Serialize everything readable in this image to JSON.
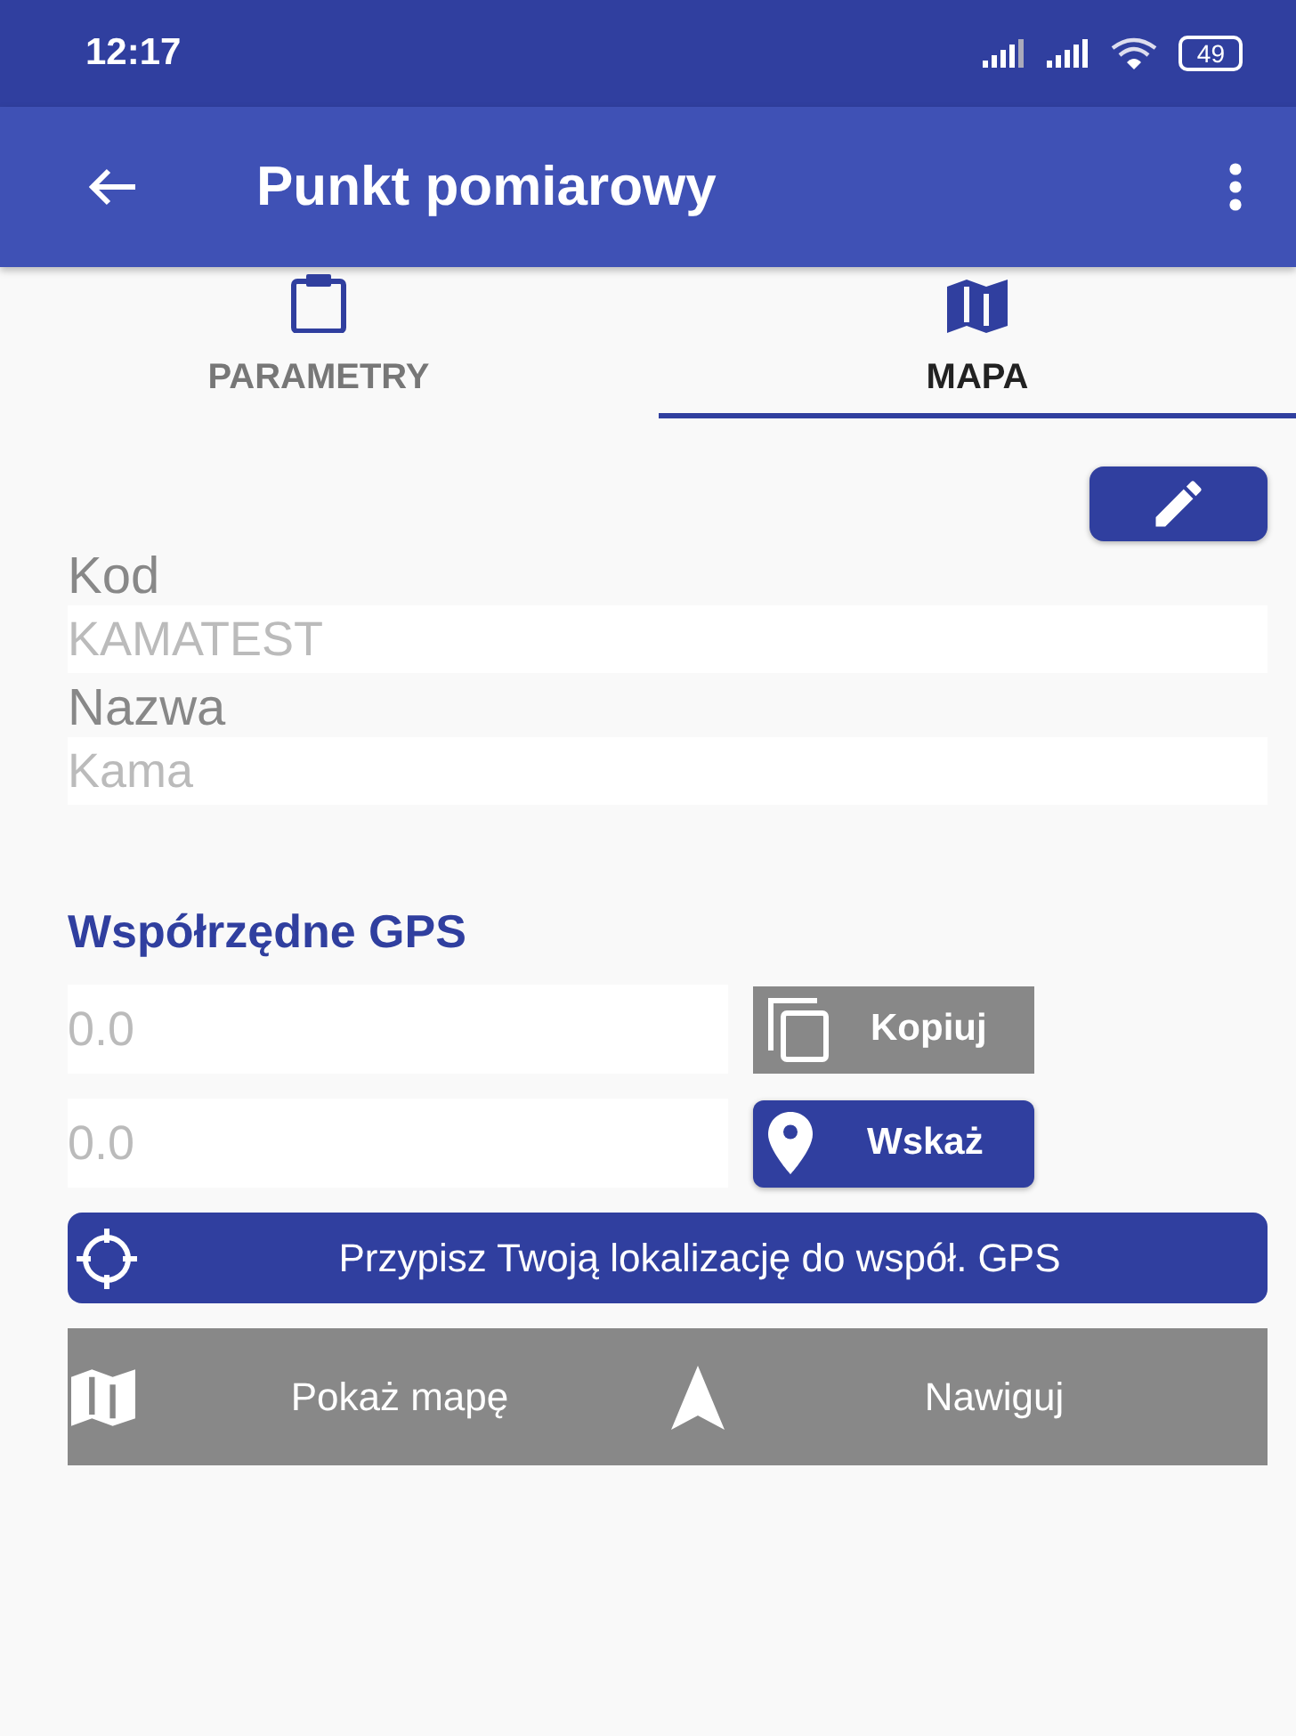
{
  "status_bar": {
    "time": "12:17",
    "battery": "49"
  },
  "app_bar": {
    "title": "Punkt pomiarowy"
  },
  "tabs": [
    {
      "label": "PARAMETRY",
      "selected": false
    },
    {
      "label": "MAPA",
      "selected": true
    }
  ],
  "fields": [
    {
      "label": "Kod",
      "value": "KAMATEST",
      "disabled": true
    },
    {
      "label": "Nazwa",
      "value": "Kama",
      "disabled": true
    }
  ],
  "gps": {
    "heading": "Współrzędne GPS",
    "rows": [
      {
        "placeholder": "0.0",
        "button": {
          "label": "Kopiuj",
          "disabled": true
        }
      },
      {
        "placeholder": "0.0",
        "button": {
          "label": "Wskaż",
          "disabled": false
        }
      }
    ],
    "assign_button": "Przypisz Twoją lokalizację do współ. GPS",
    "bottom_actions": [
      {
        "label": "Pokaż mapę"
      },
      {
        "label": "Nawiguj"
      }
    ]
  }
}
